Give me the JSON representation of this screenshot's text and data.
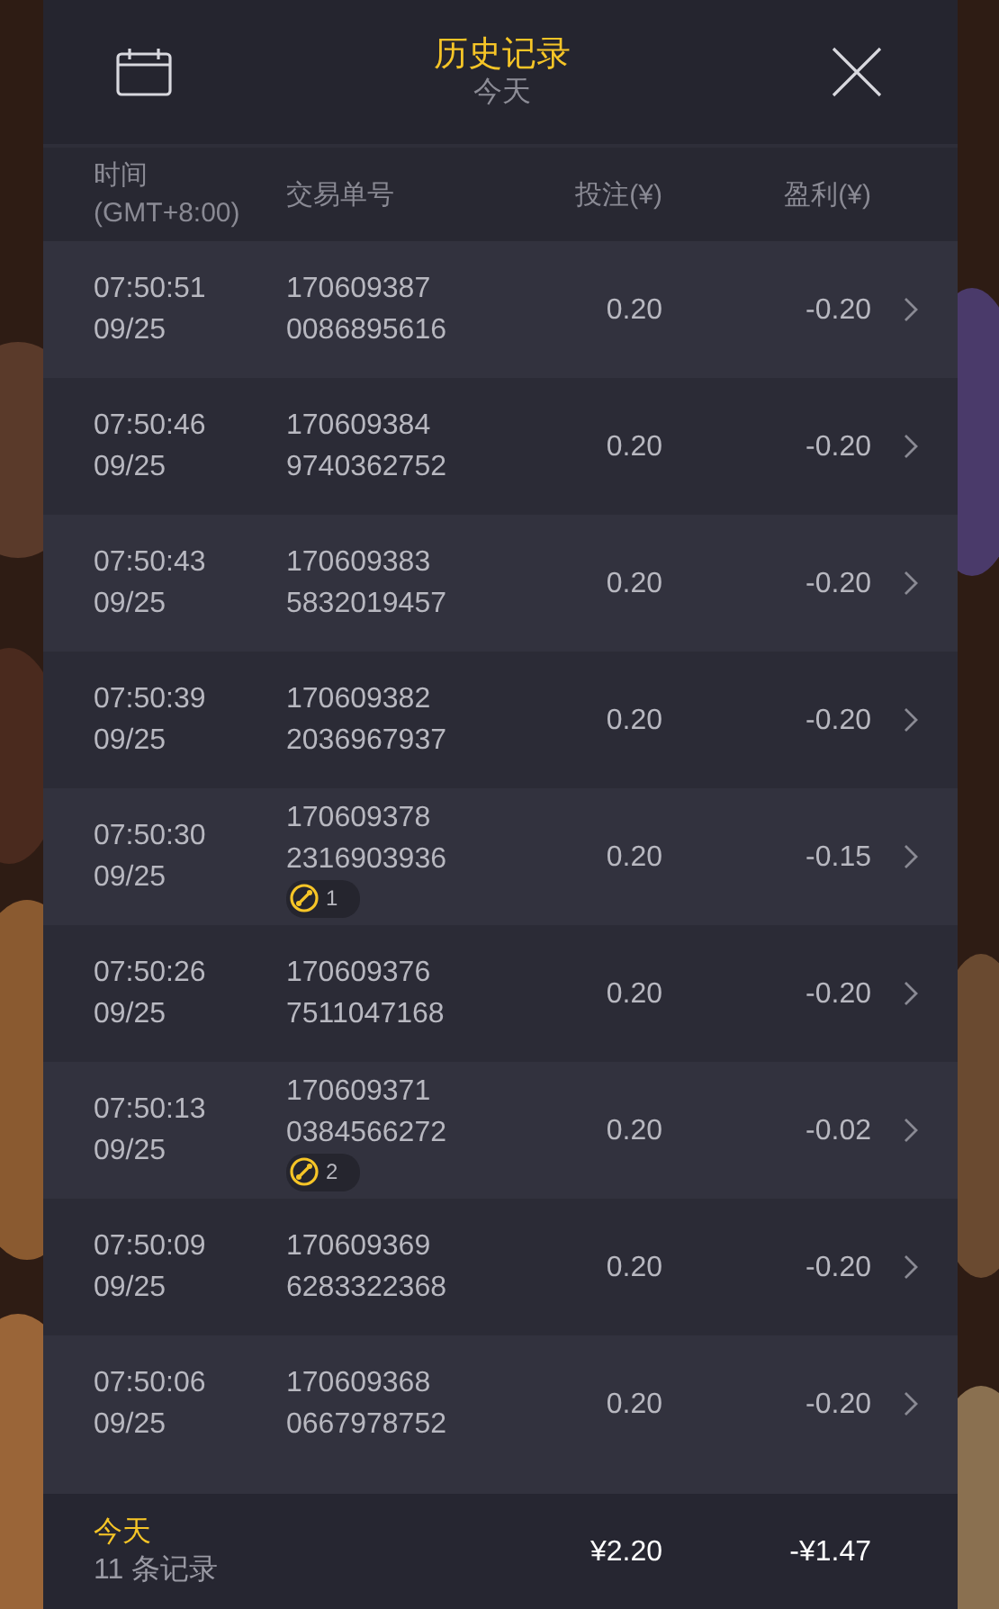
{
  "header": {
    "title": "历史记录",
    "subtitle": "今天"
  },
  "columns": [
    {
      "label": "时间",
      "sublabel": "(GMT+8:00)"
    },
    {
      "label": "交易单号"
    },
    {
      "label": "投注(¥)"
    },
    {
      "label": "盈利(¥)"
    }
  ],
  "rows": [
    {
      "time": "07:50:51",
      "date": "09/25",
      "id_1": "170609387",
      "id_2": "0086895616",
      "stake": "0.20",
      "profit": "-0.20"
    },
    {
      "time": "07:50:46",
      "date": "09/25",
      "id_1": "170609384",
      "id_2": "9740362752",
      "stake": "0.20",
      "profit": "-0.20"
    },
    {
      "time": "07:50:43",
      "date": "09/25",
      "id_1": "170609383",
      "id_2": "5832019457",
      "stake": "0.20",
      "profit": "-0.20"
    },
    {
      "time": "07:50:39",
      "date": "09/25",
      "id_1": "170609382",
      "id_2": "2036967937",
      "stake": "0.20",
      "profit": "-0.20"
    },
    {
      "time": "07:50:30",
      "date": "09/25",
      "id_1": "170609378",
      "id_2": "2316903936",
      "badge": "1",
      "stake": "0.20",
      "profit": "-0.15"
    },
    {
      "time": "07:50:26",
      "date": "09/25",
      "id_1": "170609376",
      "id_2": "7511047168",
      "stake": "0.20",
      "profit": "-0.20"
    },
    {
      "time": "07:50:13",
      "date": "09/25",
      "id_1": "170609371",
      "id_2": "0384566272",
      "badge": "2",
      "stake": "0.20",
      "profit": "-0.02"
    },
    {
      "time": "07:50:09",
      "date": "09/25",
      "id_1": "170609369",
      "id_2": "6283322368",
      "stake": "0.20",
      "profit": "-0.20"
    },
    {
      "time": "07:50:06",
      "date": "09/25",
      "id_1": "170609368",
      "id_2": "0667978752",
      "stake": "0.20",
      "profit": "-0.20"
    }
  ],
  "footer": {
    "period": "今天",
    "count": "11 条记录",
    "total_stake": "¥2.20",
    "total_profit": "-¥1.47"
  }
}
